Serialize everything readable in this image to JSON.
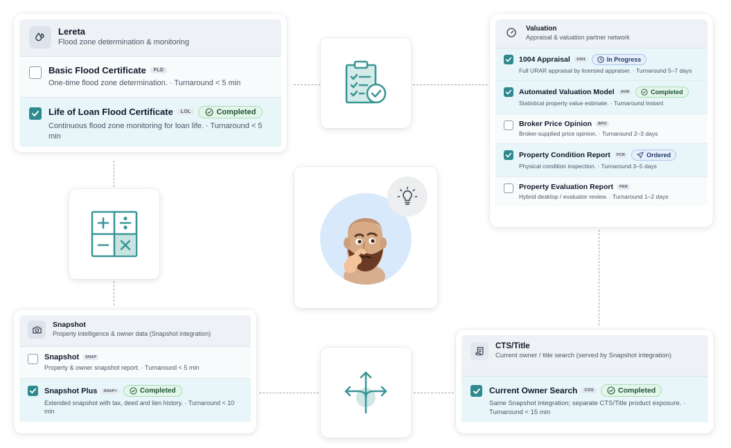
{
  "lereta": {
    "title": "Lereta",
    "subtitle": "Flood zone determination & monitoring",
    "items": [
      {
        "title": "Basic Flood Certificate",
        "code": "FLD",
        "desc": "One-time flood zone determination. · Turnaround < 5 min"
      },
      {
        "title": "Life of Loan Flood Certificate",
        "code": "LOL",
        "badge": "Completed",
        "desc": "Continuous flood zone monitoring for loan life. · Turnaround < 5 min"
      }
    ]
  },
  "valuation": {
    "title": "Valuation",
    "subtitle": "Appraisal & valuation partner network",
    "items": [
      {
        "title": "1004 Appraisal",
        "code": "1004",
        "badge": "In Progress",
        "desc": "Full URAR appraisal by licensed appraiser. · Turnaround 5–7 days"
      },
      {
        "title": "Automated Valuation Model",
        "code": "AVM",
        "badge": "Completed",
        "desc": "Statistical property value estimate. · Turnaround Instant"
      },
      {
        "title": "Broker Price Opinion",
        "code": "BPO",
        "desc": "Broker-supplied price opinion. · Turnaround 2–3 days"
      },
      {
        "title": "Property Condition Report",
        "code": "PCR",
        "badge": "Ordered",
        "desc": "Physical condition inspection. · Turnaround 3–5 days"
      },
      {
        "title": "Property Evaluation Report",
        "code": "PER",
        "desc": "Hybrid desktop / evaluator review. · Turnaround 1–2 days"
      }
    ]
  },
  "snapshot": {
    "title": "Snapshot",
    "subtitle": "Property intelligence & owner data (Snapshot integration)",
    "items": [
      {
        "title": "Snapshot",
        "code": "SNAP",
        "desc": "Property & owner snapshot report. · Turnaround < 5 min"
      },
      {
        "title": "Snapshot Plus",
        "code": "SNAP+",
        "badge": "Completed",
        "desc": "Extended snapshot with tax, deed and lien history. · Turnaround < 10 min"
      }
    ]
  },
  "cts": {
    "title": "CTS/Title",
    "subtitle": "Current owner / title search (served by Snapshot integration)",
    "items": [
      {
        "title": "Current Owner Search",
        "code": "COS",
        "badge": "Completed",
        "desc": "Same Snapshot integration; separate CTS/Title product exposure. · Turnaround < 15 min"
      }
    ]
  },
  "colors": {
    "accent": "#2f8a8f",
    "completed_bg": "#e3f6e9",
    "progress_bg": "#e6effb",
    "avatar_bg": "#d8e9fb"
  },
  "icons": {
    "lereta": "water-drop-icon",
    "valuation": "gauge-icon",
    "snapshot": "camera-icon",
    "cts": "scroll-icon",
    "tiles": [
      "clipboard-check-icon",
      "calculator-icon",
      "thinking-avatar",
      "lightbulb-icon",
      "split-arrows-icon"
    ]
  }
}
